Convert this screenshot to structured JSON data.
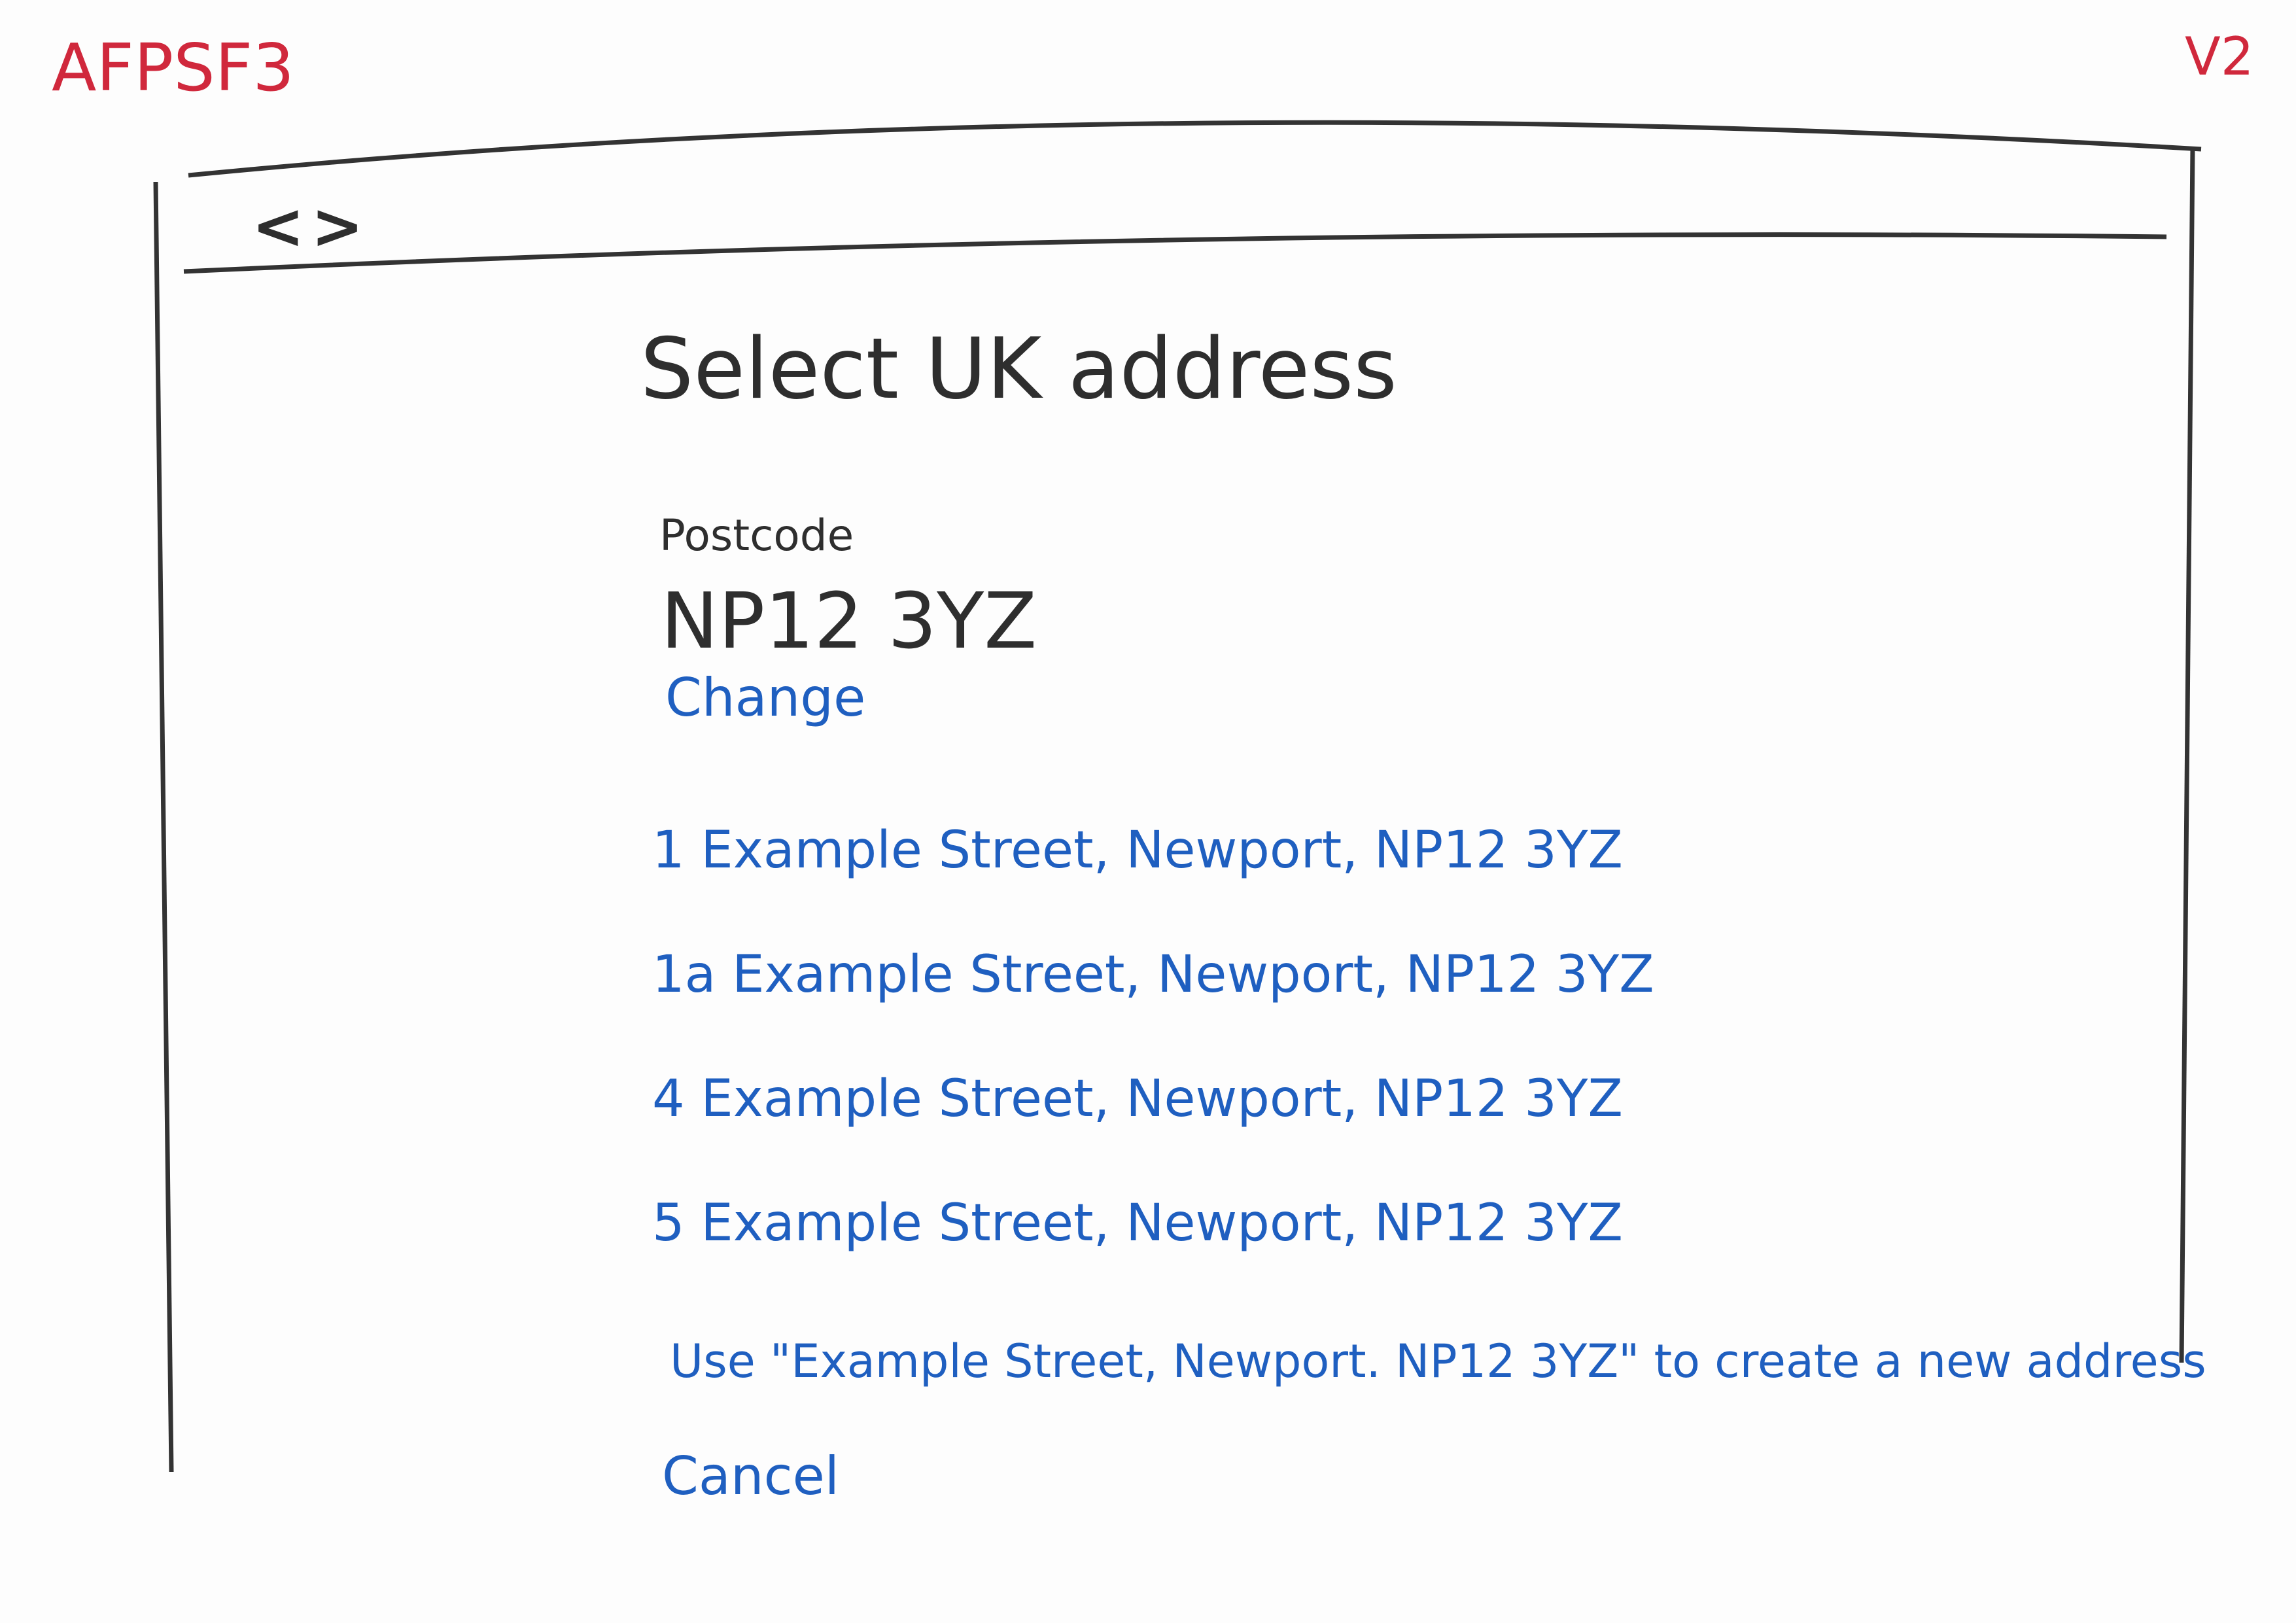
{
  "annotations": {
    "screen_id": "AFPSF3",
    "version": "V2"
  },
  "browser": {
    "nav_arrows": "<>"
  },
  "page": {
    "title": "Select UK address",
    "postcode_label": "Postcode",
    "postcode_value": "NP12 3YZ",
    "change_link": "Change",
    "addresses": [
      "1  Example Street, Newport, NP12 3YZ",
      "1a Example Street, Newport, NP12 3YZ",
      "4  Example Street, Newport, NP12 3YZ",
      "5  Example Street, Newport, NP12 3YZ"
    ],
    "use_new_address_link": "Use \"Example Street, Newport. NP12 3YZ\" to create a new address",
    "cancel_link": "Cancel"
  },
  "colors": {
    "annotation": "#d0283c",
    "ink": "#2e2e2e",
    "link": "#1f5fc0"
  }
}
